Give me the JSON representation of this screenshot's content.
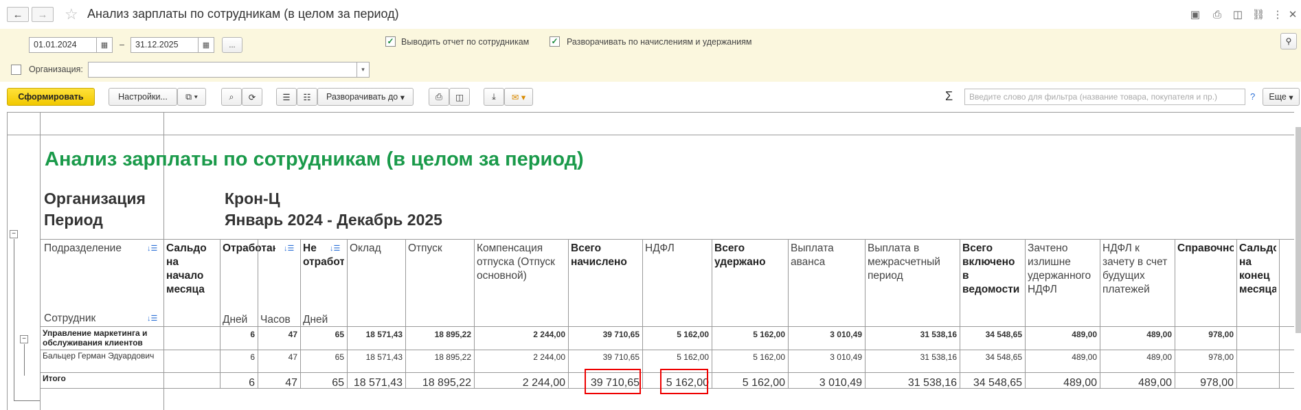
{
  "window": {
    "title": "Анализ зарплаты по сотрудникам (в целом за период)",
    "back": "←",
    "forward": "→",
    "star": "☆"
  },
  "filters": {
    "date_from": "01.01.2024",
    "dash": "–",
    "date_to": "31.12.2025",
    "ellipsis": "...",
    "cb1_label": "Выводить отчет по сотрудникам",
    "cb2_label": "Разворачивать по начислениям и удержаниям",
    "org_label": "Организация:",
    "org_value": ""
  },
  "toolbar": {
    "generate": "Сформировать",
    "settings": "Настройки...",
    "expand": "Разворачивать до",
    "sigma": "Σ",
    "filter_placeholder": "Введите слово для фильтра (название товара, покупателя и пр.)",
    "help": "?",
    "more": "Еще"
  },
  "report": {
    "title": "Анализ зарплаты по сотрудникам (в целом за период)",
    "org_label": "Организация",
    "org_value": "Крон-Ц",
    "period_label": "Период",
    "period_value": "Январь 2024 - Декабрь 2025",
    "col_dept": "Подразделение",
    "col_emp": "Сотрудник",
    "headers": [
      "Сальдо на начало месяца",
      "Отработано",
      "Не отработано",
      "Оклад",
      "Отпуск",
      "Компенсация отпуска (Отпуск основной)",
      "Всего начислено",
      "НДФЛ",
      "Всего удержано",
      "Выплата аванса",
      "Выплата в межрасчетный период",
      "Всего включено в ведомости",
      "Зачтено излишне удержанного НДФЛ",
      "НДФЛ к зачету в счет будущих платежей",
      "Справочно",
      "Сальдо на конец месяца"
    ],
    "sub": {
      "days": "Дней",
      "hours": "Часов",
      "days2": "Дней"
    },
    "rows": [
      {
        "name": "Управление маркетинга и обслуживания клиентов",
        "vals": [
          "",
          "6",
          "47",
          "65",
          "18 571,43",
          "18 895,22",
          "2 244,00",
          "39 710,65",
          "5 162,00",
          "5 162,00",
          "3 010,49",
          "31 538,16",
          "34 548,65",
          "489,00",
          "489,00",
          "978,00",
          ""
        ]
      },
      {
        "name": "Бальцер Герман Эдуардович",
        "vals": [
          "",
          "6",
          "47",
          "65",
          "18 571,43",
          "18 895,22",
          "2 244,00",
          "39 710,65",
          "5 162,00",
          "5 162,00",
          "3 010,49",
          "31 538,16",
          "34 548,65",
          "489,00",
          "489,00",
          "978,00",
          ""
        ]
      },
      {
        "name": "Итого",
        "vals": [
          "",
          "6",
          "47",
          "65",
          "18 571,43",
          "18 895,22",
          "2 244,00",
          "39 710,65",
          "5 162,00",
          "5 162,00",
          "3 010,49",
          "31 538,16",
          "34 548,65",
          "489,00",
          "489,00",
          "978,00",
          ""
        ]
      }
    ]
  }
}
